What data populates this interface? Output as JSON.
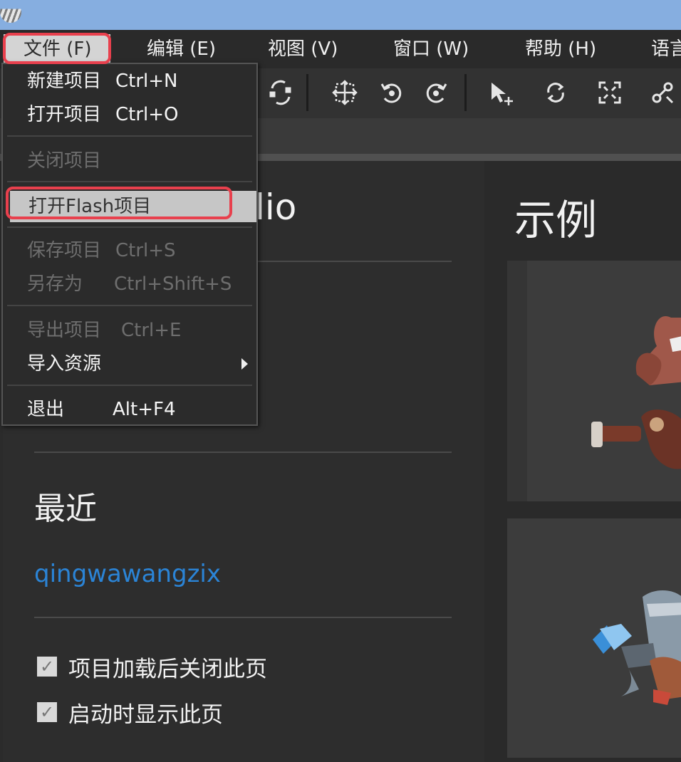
{
  "menubar": {
    "items": [
      {
        "label": "文件 (F)",
        "active": true
      },
      {
        "label": "编辑 (E)"
      },
      {
        "label": "视图 (V)"
      },
      {
        "label": "窗口 (W)"
      },
      {
        "label": "帮助 (H)"
      },
      {
        "label": "语言"
      }
    ]
  },
  "file_menu": {
    "items": [
      {
        "label": "新建项目",
        "shortcut": "Ctrl+N",
        "enabled": true
      },
      {
        "label": "打开项目",
        "shortcut": "Ctrl+O",
        "enabled": true
      },
      {
        "label": "关闭项目",
        "shortcut": "",
        "enabled": false
      },
      {
        "label": "打开Flash项目",
        "shortcut": "",
        "enabled": false,
        "highlighted": true
      },
      {
        "label": "保存项目",
        "shortcut": "Ctrl+S",
        "enabled": false
      },
      {
        "label": "另存为",
        "shortcut": "Ctrl+Shift+S",
        "enabled": false
      },
      {
        "label": "导出项目",
        "shortcut": "Ctrl+E",
        "enabled": false
      },
      {
        "label": "导入资源",
        "shortcut": "",
        "enabled": true,
        "submenu": true
      },
      {
        "label": "退出",
        "shortcut": "Alt+F4",
        "enabled": true
      }
    ]
  },
  "toolbar": {
    "icons": [
      "transform-icon",
      "center-icon",
      "rotate-ccw-icon",
      "rotate-cw-icon",
      "move-icon",
      "rotate-icon",
      "scale-icon",
      "bone-icon"
    ]
  },
  "start_page": {
    "title_fragment": "lio",
    "recent_title": "最近",
    "recent_items": [
      "qingwawangzix"
    ],
    "options": [
      {
        "label": "项目加载后关闭此页",
        "checked": true
      },
      {
        "label": "启动时显示此页",
        "checked": true
      }
    ],
    "examples_title": "示例"
  },
  "colors": {
    "title_bar": "#86aee0",
    "link": "#2b84d6",
    "highlight": "#e8404d"
  }
}
